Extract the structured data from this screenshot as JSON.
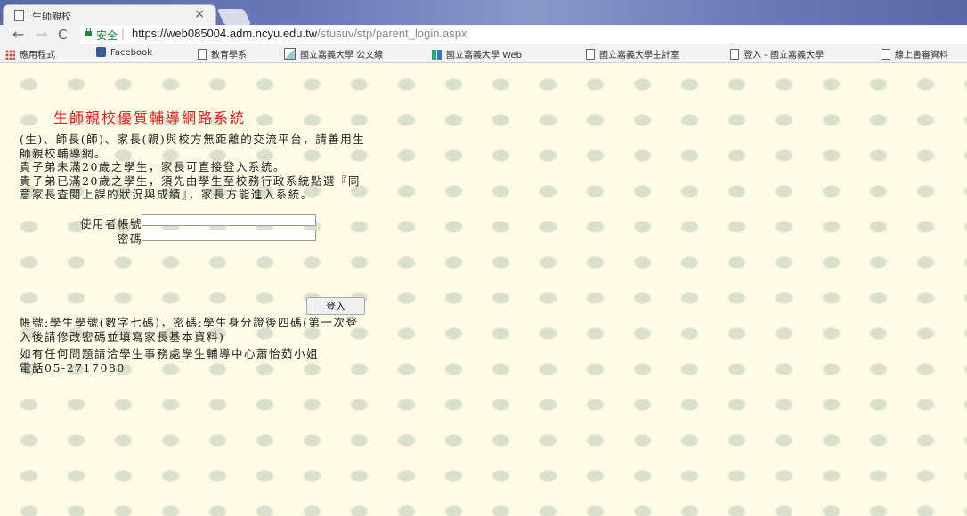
{
  "browser": {
    "tab_title": "生師親校",
    "tab_close": "×",
    "nav": {
      "back": "←",
      "forward": "→",
      "reload": "C"
    },
    "secure_label": "安全",
    "separator": "|",
    "url_host": "https://web085004.adm.ncyu.edu.tw",
    "url_path": "/stusuv/stp/parent_login.aspx",
    "bookmarks": [
      {
        "label": "應用程式",
        "icon": "apps-icon"
      },
      {
        "label": "Facebook",
        "icon": "facebook-icon"
      },
      {
        "label": "教育學系",
        "icon": "page-icon"
      },
      {
        "label": "國立嘉義大學 公文線",
        "icon": "image-icon"
      },
      {
        "label": "國立嘉義大學 Web",
        "icon": "ncyu-icon"
      },
      {
        "label": "國立嘉義大學主計室",
        "icon": "page-icon"
      },
      {
        "label": "登入 - 國立嘉義大學",
        "icon": "page-icon"
      },
      {
        "label": "線上書審資料",
        "icon": "page-icon"
      }
    ]
  },
  "page": {
    "title": "生師親校優質輔導網路系統",
    "intro": [
      "(生)、師長(師)、家長(親)與校方無距離的交流平台，請善用生師親校輔導網。",
      "貴子弟未滿20歲之學生，家長可直接登入系統。",
      "貴子弟已滿20歲之學生，須先由學生至校務行政系統點選『同意家長查閱上課的狀況與成績』，家長方能進入系統。"
    ],
    "login": {
      "username_label": "使用者帳號",
      "password_label": "密碼",
      "username_value": "",
      "password_value": "",
      "submit_label": "登入"
    },
    "notes": {
      "account_info": "帳號:學生學號(數字七碼)，密碼:學生身分證後四碼(第一次登入後請修改密碼並填寫家長基本資料)",
      "contact": "如有任何問題請洽學生事務處學生輔導中心蕭怡茹小姐",
      "phone": "電話05-2717080"
    }
  }
}
